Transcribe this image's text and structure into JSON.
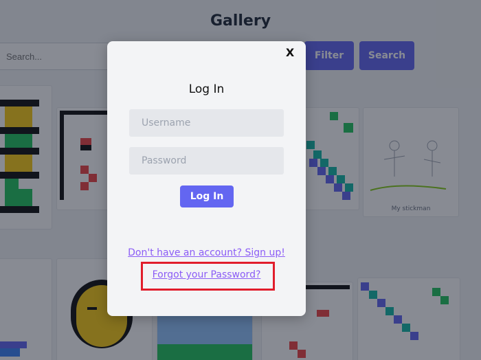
{
  "background": {
    "title": "Gallery",
    "search_placeholder": "Search...",
    "filter_label": "Filter",
    "search_label": "Search",
    "tiles": [
      {
        "caption": ""
      },
      {
        "caption": ""
      },
      {
        "caption": ""
      },
      {
        "caption": "My stickman"
      }
    ]
  },
  "modal": {
    "close_label": "X",
    "title": "Log In",
    "username_placeholder": "Username",
    "password_placeholder": "Password",
    "login_button": "Log In",
    "signup_link": "Don't have an account? Sign up!",
    "forgot_link": "Forgot your Password?"
  },
  "colors": {
    "accent": "#6366f1",
    "link": "#8b5cf6",
    "highlight": "#e11d2b"
  }
}
